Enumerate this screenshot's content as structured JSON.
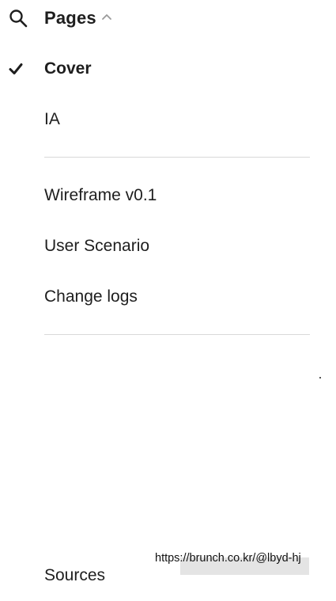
{
  "header": {
    "title": "Pages",
    "search_icon": "search-icon",
    "collapse_icon": "chevron-up-icon"
  },
  "pages": {
    "group1": [
      {
        "label": "Cover",
        "active": true
      },
      {
        "label": "IA",
        "active": false
      }
    ],
    "group2": [
      {
        "label": "Wireframe v0.1",
        "active": false
      },
      {
        "label": "User Scenario",
        "active": false
      },
      {
        "label": "Change logs",
        "active": false
      }
    ],
    "group3": [
      {
        "label": "Sources",
        "active": false
      }
    ]
  },
  "watermark": {
    "text": "https://brunch.co.kr/@lbyd-hj"
  },
  "colors": {
    "text": "#1e1e1e",
    "divider": "#d9d9d9",
    "background": "#ffffff"
  }
}
